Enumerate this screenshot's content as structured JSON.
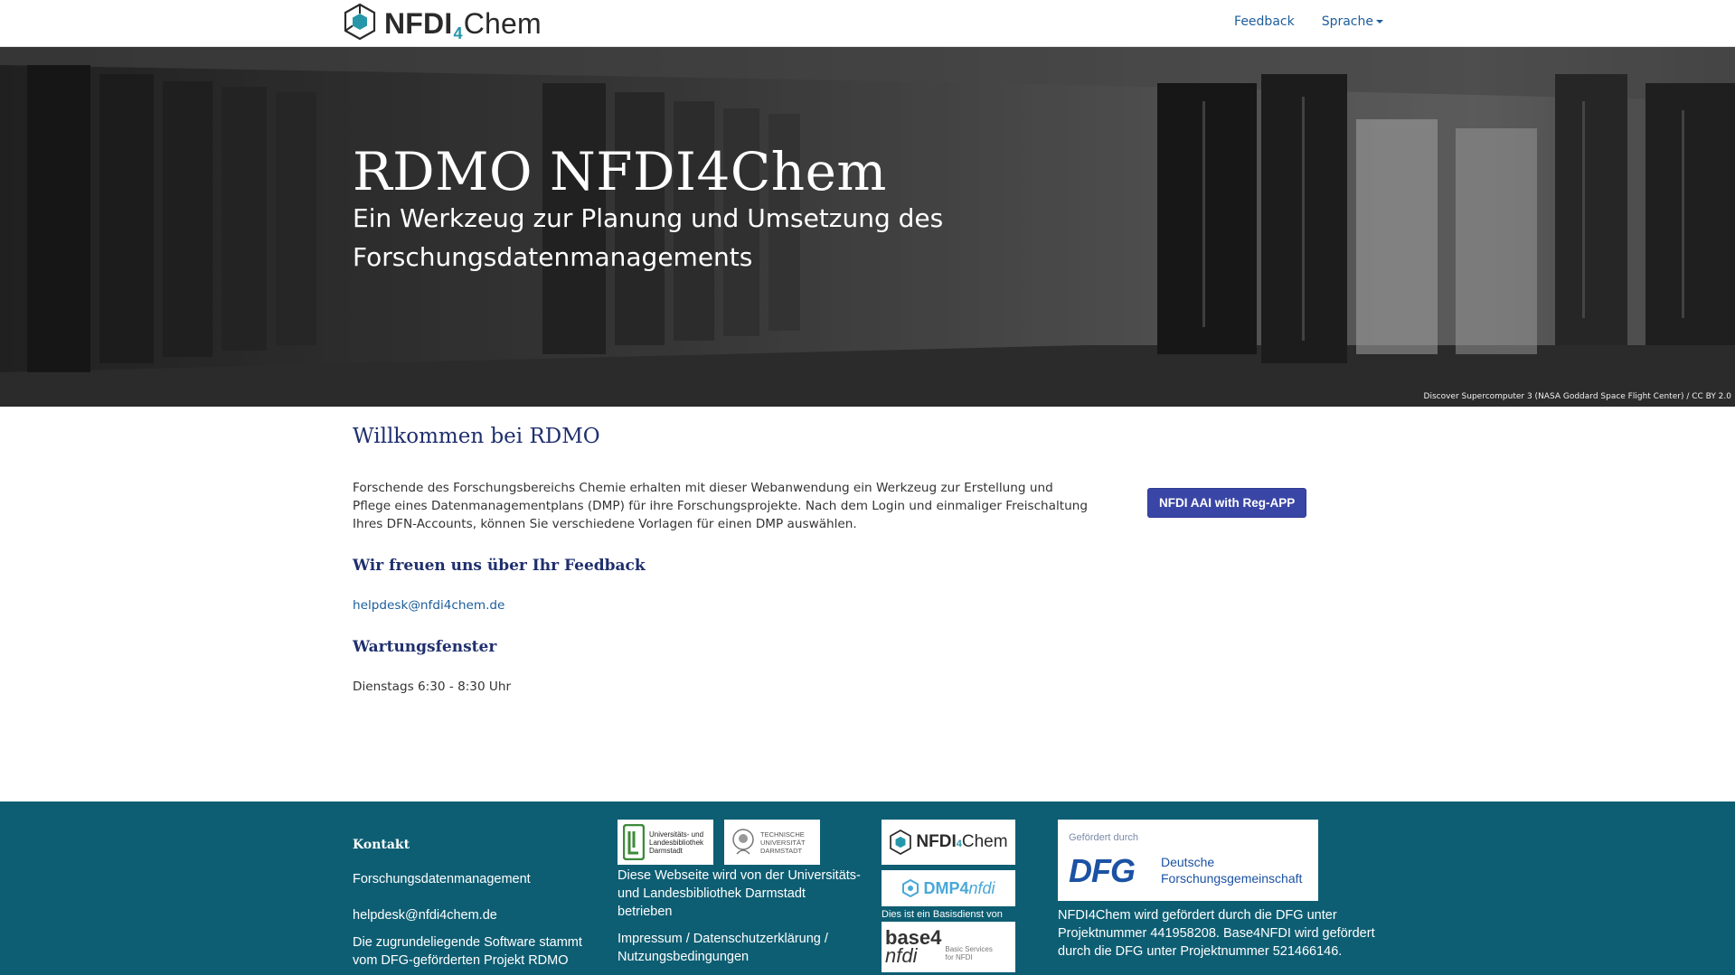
{
  "nav": {
    "brand": {
      "part1": "NFDI",
      "sub": "4",
      "part2": "Chem"
    },
    "feedback": "Feedback",
    "language": "Sprache"
  },
  "hero": {
    "title": "RDMO NFDI4Chem",
    "subtitle": "Ein Werkzeug zur Planung und Umsetzung des Forschungsdatenmanagements",
    "credit": "Discover Supercomputer 3 (NASA Goddard Space Flight Center) / CC BY 2.0"
  },
  "main": {
    "welcome": "Willkommen bei RDMO",
    "intro": "Forschende des Forschungsbereichs Chemie erhalten mit dieser Webanwendung ein Werkzeug zur Erstellung und Pflege eines Datenmanagementplans (DMP) für ihre Forschungsprojekte. Nach dem Login und einmaliger Freischaltung Ihres DFN-Accounts, können Sie verschiedene Vorlagen für einen DMP auswählen.",
    "login_button": "NFDI AAI with Reg-APP",
    "feedback_heading": "Wir freuen uns über Ihr Feedback",
    "helpdesk_email": "helpdesk@nfdi4chem.de",
    "maintenance_heading": "Wartungsfenster",
    "maintenance_text": "Dienstags 6:30 - 8:30 Uhr"
  },
  "footer": {
    "contact_heading": "Kontakt",
    "contact_line1": "Forschungsdatenmanagement",
    "contact_email": "helpdesk@nfdi4chem.de",
    "software_text": "Die zugrundeliegende Software stammt vom DFG-geförderten Projekt RDMO",
    "ulb_logo_text": "Universitäts- und Landesbibliothek Darmstadt",
    "tu_logo_text": "TECHNISCHE UNIVERSITÄT DARMSTADT",
    "hosted_text": "Diese Webseite wird von der Universitäts- und Landesbibliothek Darmstadt betrieben",
    "legal_links": "Impressum / Datenschutzerklärung / Nutzungsbedingungen",
    "nfdi4chem_logo": {
      "part1": "NFDI",
      "sub": "4",
      "part2": "Chem"
    },
    "dmp4nfdi_logo": {
      "part1": "DMP4",
      "part2": "nfdi"
    },
    "basisdienst_text": "Dies ist ein Basisdienst von",
    "base4nfdi_logo": {
      "top": "base4",
      "bottom": "nfdi",
      "caption": "Basic Services for NFDI"
    },
    "dfg_small": "Gefördert durch",
    "dfg_logo": "DFG",
    "dfg_name": "Deutsche Forschungsgemeinschaft",
    "funding_text": "NFDI4Chem wird gefördert durch die DFG unter Projektnummer 441958208. Base4NFDI wird gefördert durch die DFG unter Projektnummer 521466146."
  },
  "colors": {
    "link": "#1d5d9b",
    "heading": "#1f2f6e",
    "button": "#3a46a6",
    "footer": "#0e5e73",
    "accent": "#2697a8"
  },
  "icons": [
    "nfdi4chem-hexagon-logo-icon",
    "caret-down-icon"
  ]
}
